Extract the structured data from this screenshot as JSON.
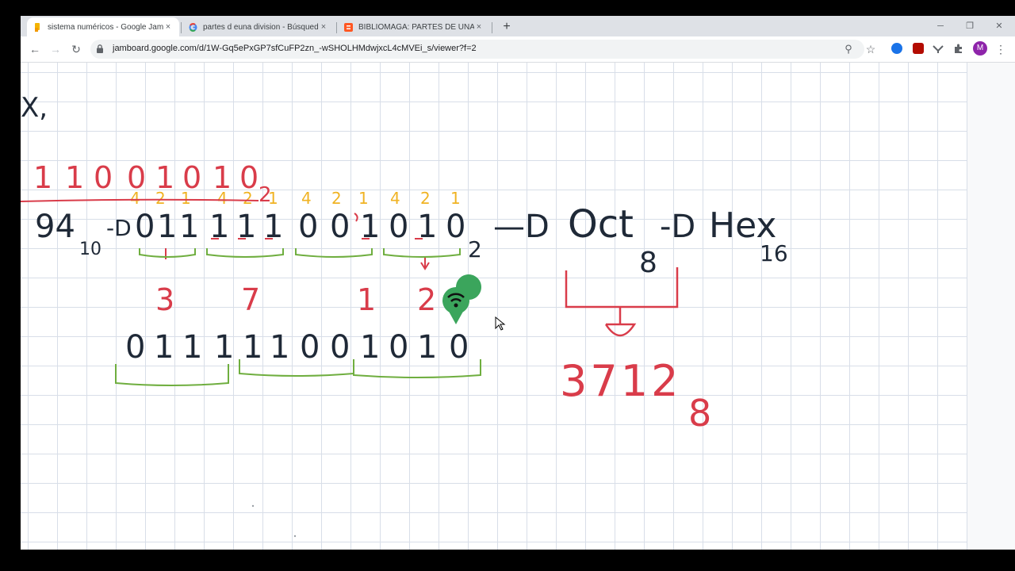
{
  "tabs": [
    {
      "title": "sistema numéricos - Google Jamboard",
      "close": "×"
    },
    {
      "title": "partes d euna division - Búsqueda de Google",
      "close": "×"
    },
    {
      "title": "BIBLIOMAGA: PARTES DE UNA DIVISIÓN",
      "close": "×"
    }
  ],
  "new_tab": "+",
  "window_controls": {
    "minimize": "─",
    "maximize": "❐",
    "close": "✕"
  },
  "toolbar": {
    "url": "jamboard.google.com/d/1W-Gq5ePxGP7sfCuFP2zn_-wSHOLHMdwjxcL4cMVEi_s/viewer?f=2",
    "back": "←",
    "forward": "→",
    "reload": "↻",
    "zoom": "⚲",
    "star": "☆",
    "menu": "⋮",
    "profile_initial": "M"
  },
  "board": {
    "top_fragment": "X,",
    "top_binary": [
      "1",
      "1",
      "0",
      "0",
      "1",
      "0",
      "1",
      "0"
    ],
    "top_base": "2",
    "decimal": "94",
    "decimal_base": "10",
    "arrow1": "-D",
    "arrow2": "—D",
    "arrow3": "-D",
    "weights": [
      "4",
      "2",
      "1",
      "4",
      "2",
      "1",
      "4",
      "2",
      "1",
      "4",
      "2",
      "1"
    ],
    "long_binary": [
      "0",
      "1",
      "1",
      "1",
      "1",
      "1",
      "0",
      "0",
      "1",
      "0",
      "1",
      "0"
    ],
    "long_base": "2",
    "octal_digits": [
      "3",
      "7",
      "1",
      "2"
    ],
    "oct_label": "Oct",
    "oct_base": "8",
    "hex_label": "Hex",
    "hex_base": "16",
    "bottom_binary": [
      "0",
      "1",
      "1",
      "1",
      "1",
      "1",
      "0",
      "0",
      "1",
      "0",
      "1",
      "0"
    ],
    "result": "3712",
    "result_base": "8",
    "accent_colors": {
      "black": "#1f2937",
      "red": "#d93c4a",
      "green": "#6fae3f",
      "yellow": "#f0b323"
    }
  }
}
